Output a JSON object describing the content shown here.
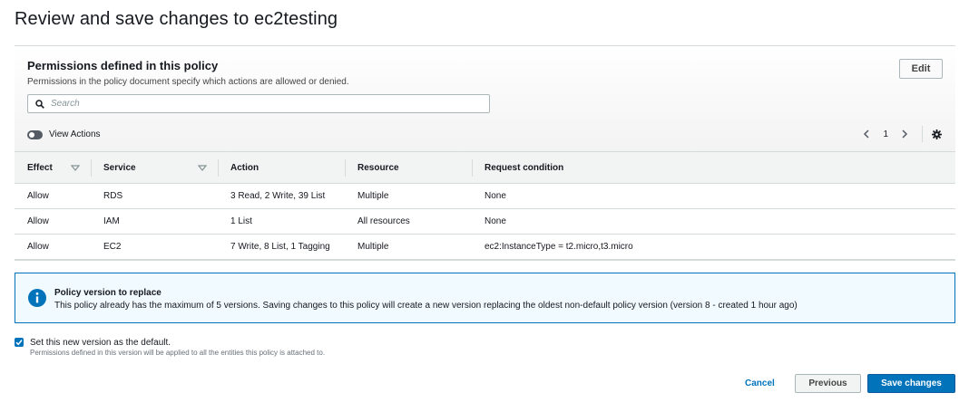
{
  "page": {
    "title": "Review and save changes to ec2testing"
  },
  "permissions": {
    "title": "Permissions defined in this policy",
    "description": "Permissions in the policy document specify which actions are allowed or denied.",
    "edit_label": "Edit",
    "search_placeholder": "Search",
    "toggle_label": "View Actions",
    "current_page": "1",
    "columns": [
      "Effect",
      "Service",
      "Action",
      "Resource",
      "Request condition"
    ],
    "rows": [
      {
        "effect": "Allow",
        "service": "RDS",
        "action": "3 Read, 2 Write, 39 List",
        "resource": "Multiple",
        "condition": "None"
      },
      {
        "effect": "Allow",
        "service": "IAM",
        "action": "1 List",
        "resource": "All resources",
        "condition": "None"
      },
      {
        "effect": "Allow",
        "service": "EC2",
        "action": "7 Write, 8 List, 1 Tagging",
        "resource": "Multiple",
        "condition": "ec2:InstanceType = t2.micro,t3.micro"
      }
    ]
  },
  "info": {
    "title": "Policy version to replace",
    "text": "This policy already has the maximum of 5 versions. Saving changes to this policy will create a new version replacing the oldest non-default policy version (version 8 - created 1 hour ago)"
  },
  "default_version": {
    "checked": true,
    "label": "Set this new version as the default.",
    "description": "Permissions defined in this version will be applied to all the entities this policy is attached to."
  },
  "footer": {
    "cancel_label": "Cancel",
    "previous_label": "Previous",
    "save_label": "Save changes"
  },
  "colors": {
    "primary": "#0073bb",
    "info_background": "#f1faff",
    "header_background": "#f2f3f3"
  }
}
